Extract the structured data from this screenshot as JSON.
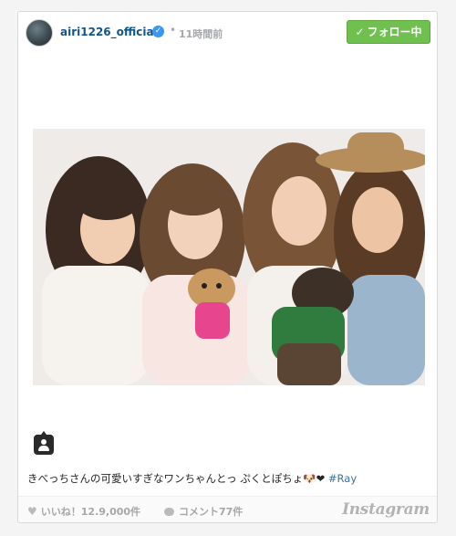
{
  "header": {
    "username": "airi1226_official",
    "verified_mark": "✓",
    "separator": "•",
    "timestamp": "11時間前",
    "follow_button": {
      "check": "✓",
      "label": "フォロー中"
    }
  },
  "post": {
    "caption_text": "きべっちさんの可愛いすぎなワンちゃんとっ ぷくとぽちょ🐶❤ ",
    "hashtag": "#Ray"
  },
  "footer": {
    "heart": "♥",
    "likes_label": "いいね！12.9,000件",
    "comments_label": "コメント77件",
    "brand": "Instagram"
  },
  "icons": {
    "avatar": "profile-photo",
    "verified": "verified-badge-icon",
    "tag": "person-tag-icon",
    "like": "heart-icon",
    "comment": "comment-bubble-icon"
  },
  "colors": {
    "username": "#125688",
    "follow_button": "#70c050",
    "hashtag": "#3f729b",
    "muted": "#a5a7aa"
  }
}
